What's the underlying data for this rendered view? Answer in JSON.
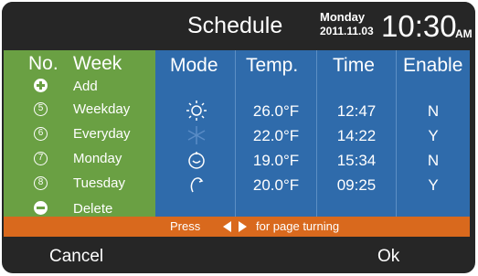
{
  "header": {
    "title": "Schedule",
    "day": "Monday",
    "date": "2011.11.03",
    "time": "10:30",
    "ampm": "AM"
  },
  "columns": {
    "no": "No.",
    "week": "Week",
    "mode": "Mode",
    "temp": "Temp.",
    "time": "Time",
    "enable": "Enable"
  },
  "actions": {
    "add": "Add",
    "delete": "Delete"
  },
  "rows": [
    {
      "no": "5",
      "week": "Weekday",
      "mode": "sun-icon",
      "temp": "26.0°F",
      "time": "12:47",
      "enable": "N"
    },
    {
      "no": "6",
      "week": "Everyday",
      "mode": "snowflake-icon",
      "temp": "22.0°F",
      "time": "14:22",
      "enable": "Y"
    },
    {
      "no": "7",
      "week": "Monday",
      "mode": "drop-icon",
      "temp": "19.0°F",
      "time": "15:34",
      "enable": "N"
    },
    {
      "no": "8",
      "week": "Tuesday",
      "mode": "fan-icon",
      "temp": "20.0°F",
      "time": "09:25",
      "enable": "Y"
    }
  ],
  "hint": {
    "prefix": "Press",
    "suffix": "for page turning"
  },
  "footer": {
    "cancel": "Cancel",
    "ok": "Ok"
  },
  "colors": {
    "green_panel": "#6aa043",
    "blue_panel": "#2f6bab",
    "orange_bar": "#d9691d",
    "background": "#262626"
  }
}
